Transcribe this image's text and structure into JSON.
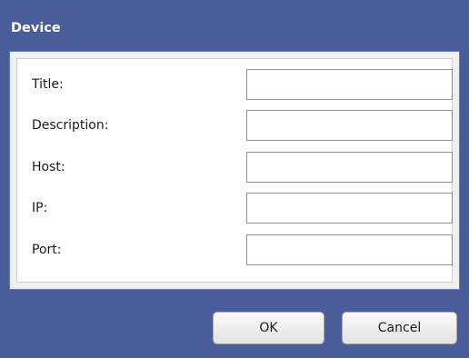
{
  "dialog": {
    "title": "Device"
  },
  "form": {
    "fields": [
      {
        "label": "Title:",
        "value": "",
        "placeholder": ""
      },
      {
        "label": "Description:",
        "value": "",
        "placeholder": ""
      },
      {
        "label": "Host:",
        "value": "",
        "placeholder": ""
      },
      {
        "label": "IP:",
        "value": "",
        "placeholder": ""
      },
      {
        "label": "Port:",
        "value": "",
        "placeholder": ""
      }
    ]
  },
  "buttons": {
    "ok_label": "OK",
    "cancel_label": "Cancel"
  },
  "colors": {
    "header_background": "#4a5d9b",
    "panel_background": "#ffffff",
    "button_background": "#f0f0f0"
  }
}
